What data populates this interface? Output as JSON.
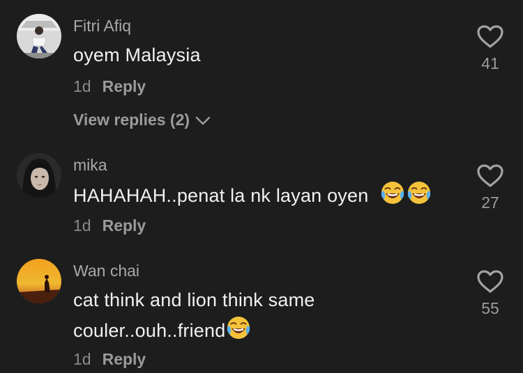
{
  "comments": [
    {
      "username": "Fitri Afiq",
      "text": "oyem Malaysia",
      "time": "1d",
      "reply_label": "Reply",
      "likes": "41",
      "view_replies": "View replies (2)"
    },
    {
      "username": "mika",
      "text": "HAHAHAH..penat la nk layan oyen",
      "time": "1d",
      "reply_label": "Reply",
      "likes": "27",
      "emojis": [
        "face-with-tears-of-joy",
        "face-with-tears-of-joy"
      ]
    },
    {
      "username": "Wan chai",
      "text_line1": "cat think and lion think same",
      "text_line2": "couler..ouh..friend",
      "time": "1d",
      "reply_label": "Reply",
      "likes": "55",
      "emojis": [
        "face-with-tears-of-joy"
      ]
    }
  ],
  "colors": {
    "background": "#1d1d1d",
    "text": "#f1f1f1",
    "muted": "#9b9b9b"
  }
}
